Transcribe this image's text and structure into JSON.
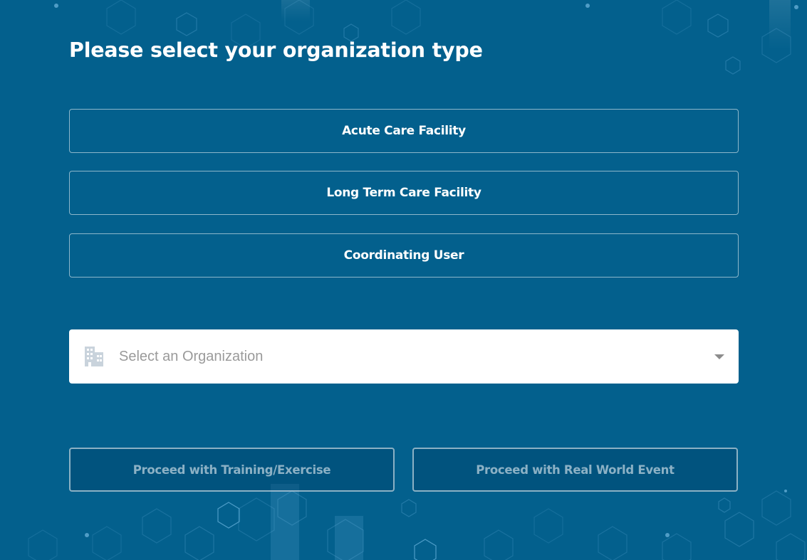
{
  "page": {
    "title": "Please select your organization type"
  },
  "organization_types": [
    {
      "label": "Acute Care Facility"
    },
    {
      "label": "Long Term Care Facility"
    },
    {
      "label": "Coordinating User"
    }
  ],
  "organization_select": {
    "placeholder": "Select an Organization",
    "icon": "building-icon",
    "dropdown_icon": "caret-down-icon"
  },
  "actions": {
    "training_label": "Proceed with Training/Exercise",
    "real_world_label": "Proceed with Real World Event",
    "enabled": false
  },
  "colors": {
    "background": "#03608d",
    "button_text": "#ffffff",
    "placeholder": "#9a9a9a"
  }
}
